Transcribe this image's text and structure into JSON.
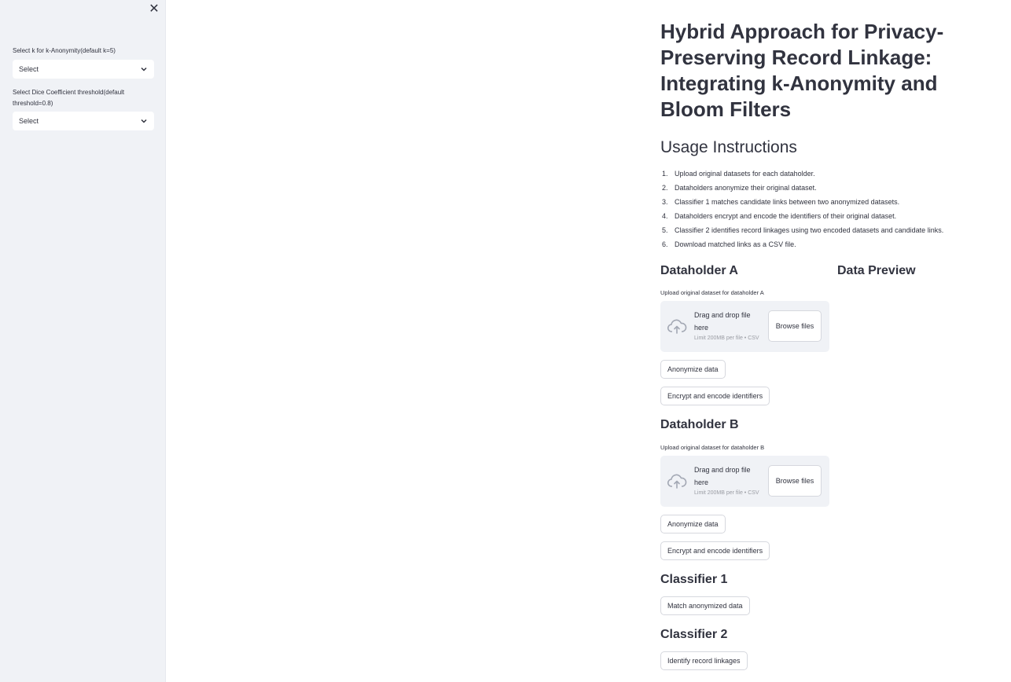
{
  "sidebar": {
    "close_icon": "close-icon",
    "k_select": {
      "label": "Select k for k-Anonymity(default k=5)",
      "value": "Select"
    },
    "dice_select": {
      "label": "Select Dice Coefficient threshold(default threshold=0.8)",
      "value": "Select"
    }
  },
  "main": {
    "title": "Hybrid Approach for Privacy-Preserving Record Linkage: Integrating k-Anonymity and Bloom Filters",
    "usage_heading": "Usage Instructions",
    "steps": [
      "Upload original datasets for each dataholder.",
      "Dataholders anonymize their original dataset.",
      "Classifier 1 matches candidate links between two anonymized datasets.",
      "Dataholders encrypt and encode the identifiers of their original dataset.",
      "Classifier 2 identifies record linkages using two encoded datasets and candidate links.",
      "Download matched links as a CSV file."
    ],
    "dataholder_a": {
      "heading": "Dataholder A",
      "upload_label": "Upload original dataset for dataholder A",
      "drop_text": "Drag and drop file here",
      "limit_text": "Limit 200MB per file • CSV",
      "browse_label": "Browse files",
      "anonymize_label": "Anonymize data",
      "encrypt_label": "Encrypt and encode identifiers"
    },
    "data_preview_heading": "Data Preview",
    "dataholder_b": {
      "heading": "Dataholder B",
      "upload_label": "Upload original dataset for dataholder B",
      "drop_text": "Drag and drop file here",
      "limit_text": "Limit 200MB per file • CSV",
      "browse_label": "Browse files",
      "anonymize_label": "Anonymize data",
      "encrypt_label": "Encrypt and encode identifiers"
    },
    "classifier_1": {
      "heading": "Classifier 1",
      "button_label": "Match anonymized data"
    },
    "classifier_2": {
      "heading": "Classifier 2",
      "button_label": "Identify record linkages"
    }
  }
}
